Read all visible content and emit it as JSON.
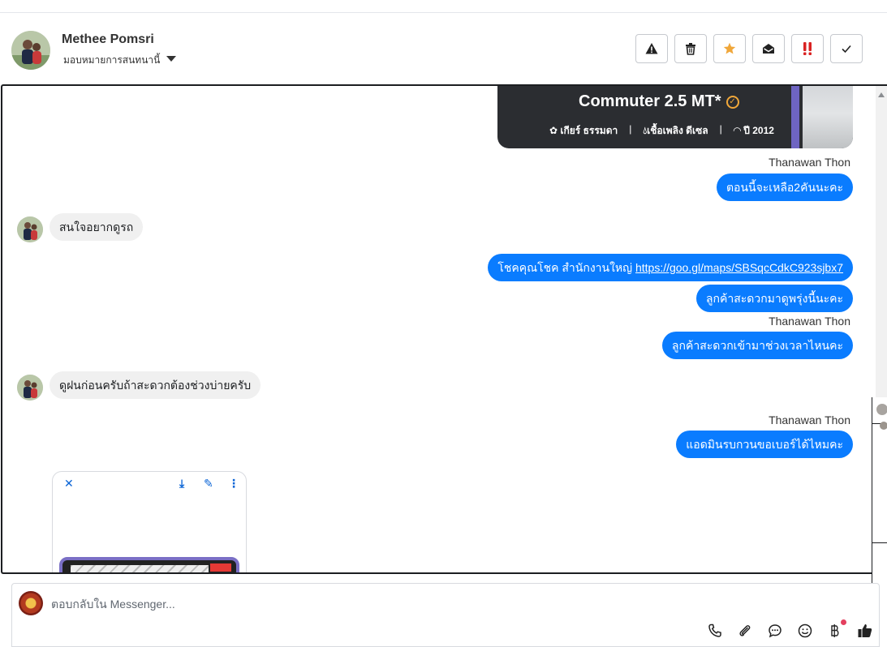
{
  "contact": {
    "name": "Methee Pomsri",
    "assign_label": "มอบหมายการสนทนานี้"
  },
  "actions": [
    {
      "name": "spam-button",
      "icon": "warning-icon"
    },
    {
      "name": "delete-button",
      "icon": "trash-icon"
    },
    {
      "name": "star-button",
      "icon": "star-icon"
    },
    {
      "name": "mark-unread-button",
      "icon": "envelope-open-icon"
    },
    {
      "name": "follow-up-button",
      "icon": "double-exclamation-icon"
    },
    {
      "name": "done-button",
      "icon": "check-icon"
    }
  ],
  "card": {
    "title": "Commuter 2.5 MT*",
    "gear": "เกียร์ ธรรมดา",
    "fuel": "เชื้อเพลิง ดีเซล",
    "year": "ปี 2012",
    "separator": "|"
  },
  "messages": {
    "sender_1": "Thanawan Thon",
    "out_1": "ตอนนี้จะเหลือ2คันนะคะ",
    "in_1": "สนใจอยากดูรถ",
    "out_2_prefix": "โชคคุณโชค สำนักงานใหญ่ ",
    "out_2_link": "https://goo.gl/maps/SBSqcCdkC923sjbx7",
    "out_3": "ลูกค้าสะดวกมาดูพรุ่งนี้นะคะ",
    "sender_2": "Thanawan Thon",
    "out_4": "ลูกค้าสะดวกเข้ามาช่วงเวลาไหนคะ",
    "in_2": "ดูฝนก่อนครับถ้าสะดวกต้องช่วงบ่ายครับ",
    "sender_3": "Thanawan Thon",
    "out_5": "แอดมินรบกวนขอเบอร์ได้ไหมคะ"
  },
  "viewer": {
    "close": "✕",
    "download": "⤓",
    "edit": "✎",
    "more": "⋮"
  },
  "composer": {
    "placeholder": "ตอบกลับใน Messenger..."
  },
  "tools": [
    "phone-icon",
    "paperclip-icon",
    "chat-bubble-icon",
    "emoji-icon",
    "baht-icon",
    "thumbs-up-icon"
  ],
  "colors": {
    "outgoing_bubble": "#0a7cff",
    "incoming_bubble": "#f0f0f0",
    "star": "#f0a73a",
    "follow_up": "#d92222"
  }
}
